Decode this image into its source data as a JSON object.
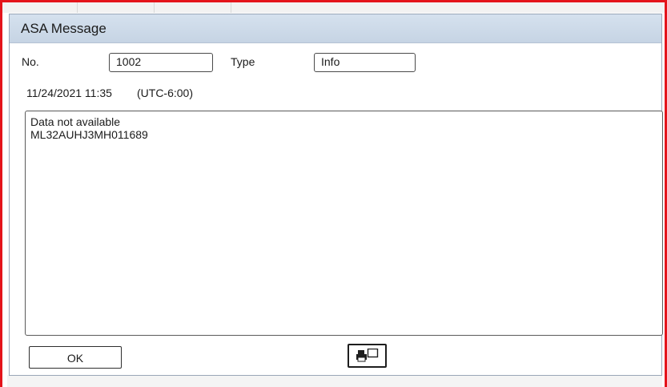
{
  "dialog": {
    "title": "ASA Message",
    "number_label": "No.",
    "number_value": "1002",
    "type_label": "Type",
    "type_value": "Info",
    "datetime": "11/24/2021 11:35",
    "timezone": "(UTC-6:00)",
    "message_lines": [
      "Data not available",
      "ML32AUHJ3MH011689"
    ],
    "ok_label": "OK",
    "print_icon": "printer-window-icon"
  },
  "colors": {
    "frame_highlight": "#e4141b",
    "title_bar": "#c9d7e7",
    "border": "#4a4a4a"
  }
}
